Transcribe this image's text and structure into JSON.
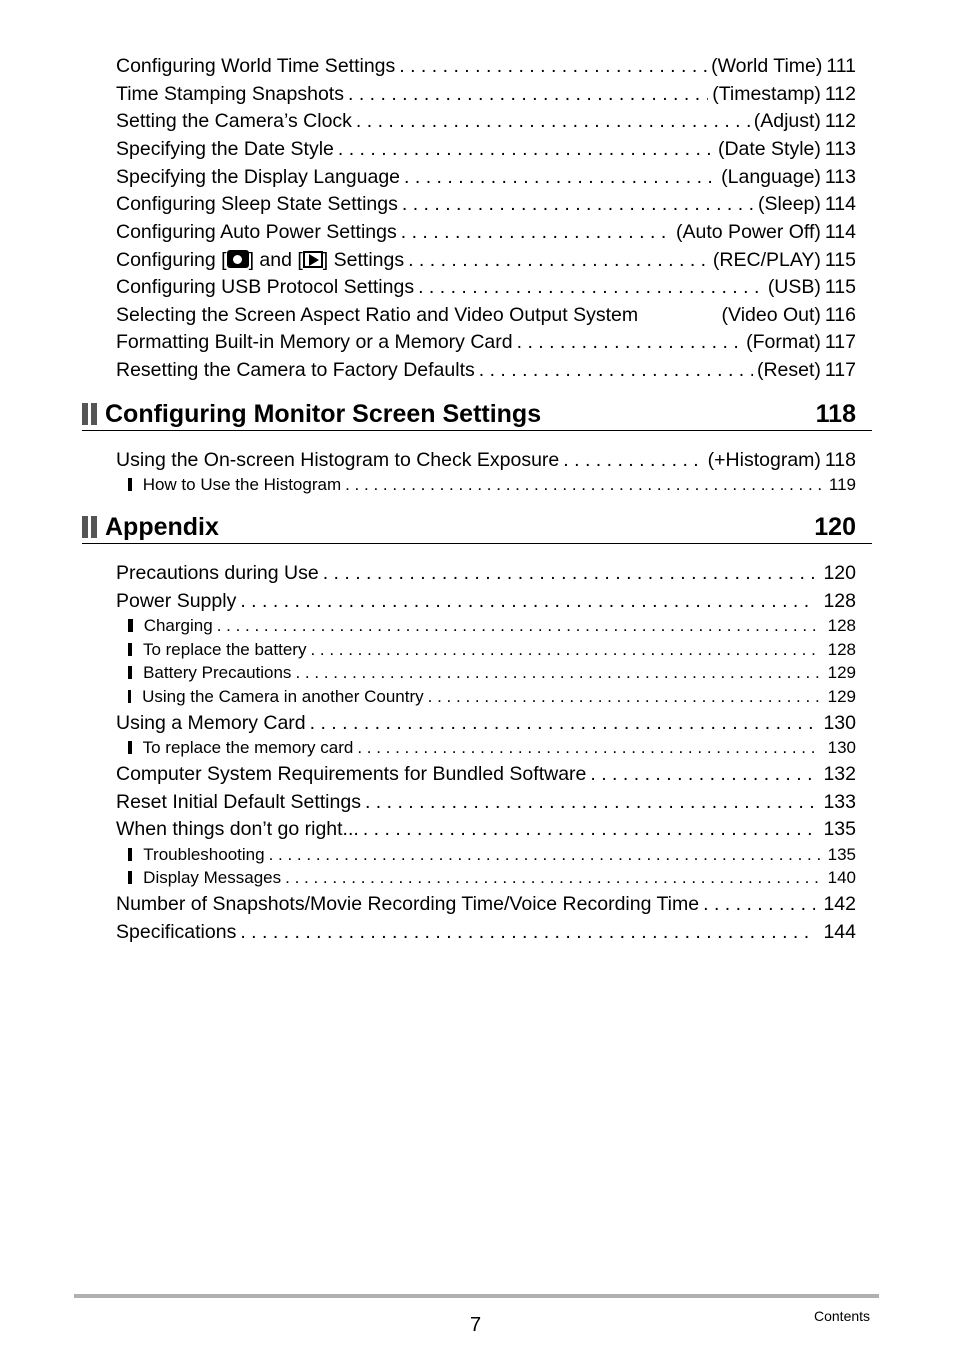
{
  "entries_top": [
    {
      "title": "Configuring World Time Settings",
      "key": "(World Time)",
      "page": "111"
    },
    {
      "title": "Time Stamping Snapshots",
      "key": "(Timestamp)",
      "page": "112"
    },
    {
      "title": "Setting the Camera’s Clock",
      "key": "(Adjust)",
      "page": "112"
    },
    {
      "title": "Specifying the Date Style",
      "key": "(Date Style)",
      "page": "113"
    },
    {
      "title": "Specifying the Display Language",
      "key": "(Language)",
      "page": "113"
    },
    {
      "title": "Configuring Sleep State Settings",
      "key": "(Sleep)",
      "page": "114"
    },
    {
      "title": "Configuring Auto Power Settings",
      "key": "(Auto Power Off)",
      "page": "114"
    },
    {
      "title_pre": "Configuring [",
      "title_mid": "] and [",
      "title_post": "] Settings",
      "icons": [
        "camera-icon",
        "play-icon"
      ],
      "key": "(REC/PLAY)",
      "page": "115"
    },
    {
      "title": "Configuring USB Protocol Settings",
      "key": "(USB)",
      "page": "115"
    },
    {
      "title": "Selecting the Screen Aspect Ratio and Video Output System",
      "key": "(Video Out)",
      "page": "116"
    },
    {
      "title": "Formatting Built-in Memory or a Memory Card",
      "key": "(Format)",
      "page": "117"
    },
    {
      "title": "Resetting the Camera to Factory Defaults",
      "key": "(Reset)",
      "page": "117"
    }
  ],
  "section_monitor": {
    "title": "Configuring Monitor Screen Settings",
    "page": "118",
    "entries": [
      {
        "title": "Using the On-screen Histogram to Check Exposure",
        "key": "(+Histogram)",
        "page": "118"
      },
      {
        "title": "How to Use the Histogram",
        "page": "119",
        "sub": true
      }
    ]
  },
  "section_appendix": {
    "title": "Appendix",
    "page": "120",
    "entries": [
      {
        "title": "Precautions during Use",
        "page": "120"
      },
      {
        "title": "Power Supply",
        "page": "128"
      },
      {
        "title": "Charging",
        "page": "128",
        "sub": true
      },
      {
        "title": "To replace the battery",
        "page": "128",
        "sub": true
      },
      {
        "title": "Battery Precautions",
        "page": "129",
        "sub": true
      },
      {
        "title": "Using the Camera in another Country",
        "page": "129",
        "sub": true
      },
      {
        "title": "Using a Memory Card",
        "page": "130"
      },
      {
        "title": "To replace the memory card",
        "page": "130",
        "sub": true
      },
      {
        "title": "Computer System Requirements for Bundled Software",
        "page": "132"
      },
      {
        "title": "Reset Initial Default Settings",
        "page": "133"
      },
      {
        "title": "When things don’t go right...",
        "page": "135"
      },
      {
        "title": "Troubleshooting",
        "page": "135",
        "sub": true
      },
      {
        "title": "Display Messages",
        "page": "140",
        "sub": true
      },
      {
        "title": "Number of Snapshots/Movie Recording Time/Voice Recording Time",
        "page": "142"
      },
      {
        "title": "Specifications",
        "page": "144"
      }
    ]
  },
  "footer": {
    "page_number": "7",
    "label": "Contents"
  }
}
